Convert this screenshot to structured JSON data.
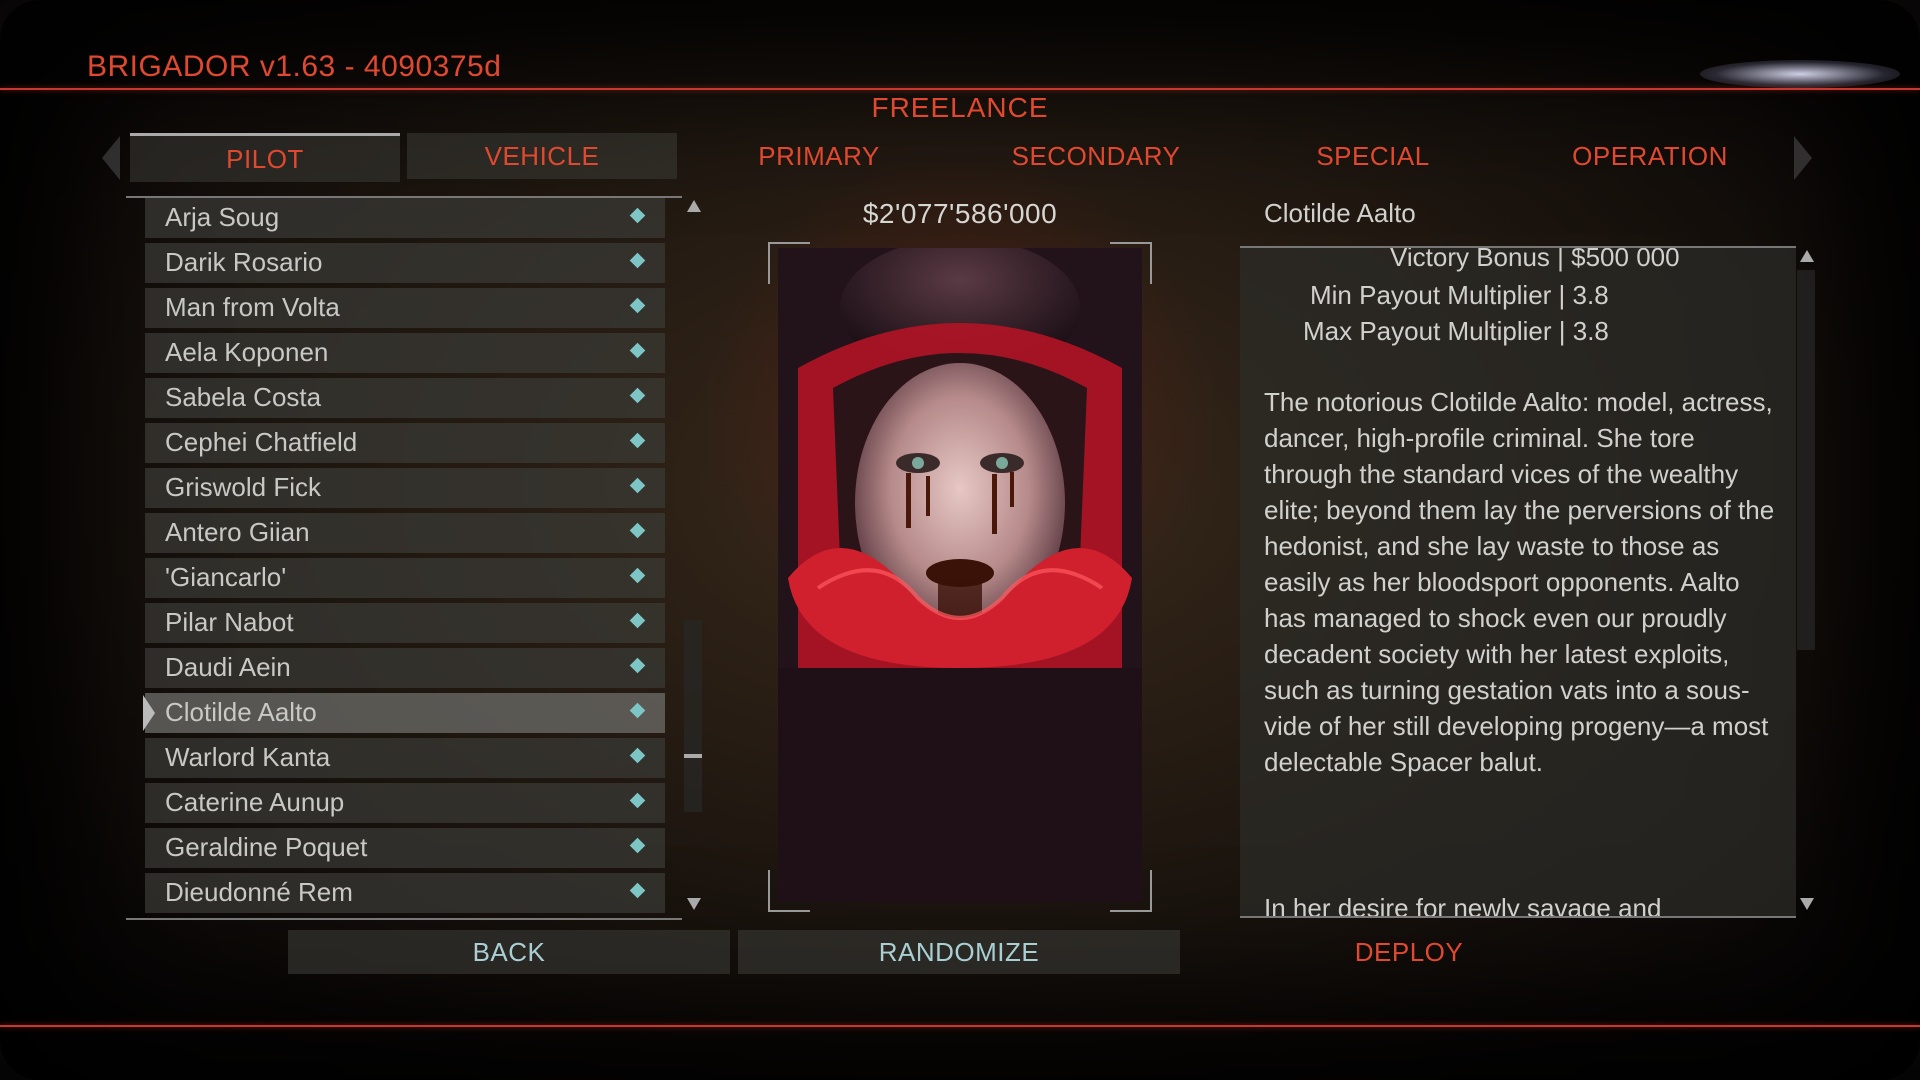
{
  "app_title": "BRIGADOR v1.63 - 4090375d",
  "mode_label": "FREELANCE",
  "tabs": [
    {
      "label": "PILOT"
    },
    {
      "label": "VEHICLE"
    },
    {
      "label": "PRIMARY"
    },
    {
      "label": "SECONDARY"
    },
    {
      "label": "SPECIAL"
    },
    {
      "label": "OPERATION"
    }
  ],
  "pilots": [
    {
      "name": "Arja Soug"
    },
    {
      "name": "Darik Rosario"
    },
    {
      "name": "Man from Volta"
    },
    {
      "name": "Aela Koponen"
    },
    {
      "name": "Sabela Costa"
    },
    {
      "name": "Cephei Chatfield"
    },
    {
      "name": "Griswold Fick"
    },
    {
      "name": "Antero Giian"
    },
    {
      "name": "'Giancarlo'"
    },
    {
      "name": "Pilar Nabot"
    },
    {
      "name": "Daudi Aein"
    },
    {
      "name": "Clotilde Aalto"
    },
    {
      "name": "Warlord Kanta"
    },
    {
      "name": "Caterine Aunup"
    },
    {
      "name": "Geraldine Poquet"
    },
    {
      "name": "Dieudonné Rem"
    }
  ],
  "selected_pilot_index": 11,
  "price": "$2'077'586'000",
  "selected": {
    "name": "Clotilde Aalto",
    "stats": [
      "Victory Bonus | $500 000",
      "Min Payout Multiplier | 3.8",
      "Max Payout Multiplier | 3.8"
    ],
    "description": "The notorious Clotilde Aalto: model, actress, dancer, high-profile criminal. She tore through the standard vices of the wealthy elite; beyond them lay the perversions of the hedonist, and she lay waste to those as easily as her bloodsport opponents. Aalto has managed to shock even our proudly decadent society with her latest exploits, such as turning gestation vats into a sous-vide of her still developing progeny—a most delectable Spacer balut.",
    "description_more": "In her desire for newly savage and"
  },
  "buttons": {
    "back": "BACK",
    "randomize": "RANDOMIZE",
    "deploy": "DEPLOY"
  },
  "colors": {
    "accent_red": "#e0492f",
    "diamond_teal": "#7ec6c6",
    "button_text": "#a9cfd3"
  }
}
